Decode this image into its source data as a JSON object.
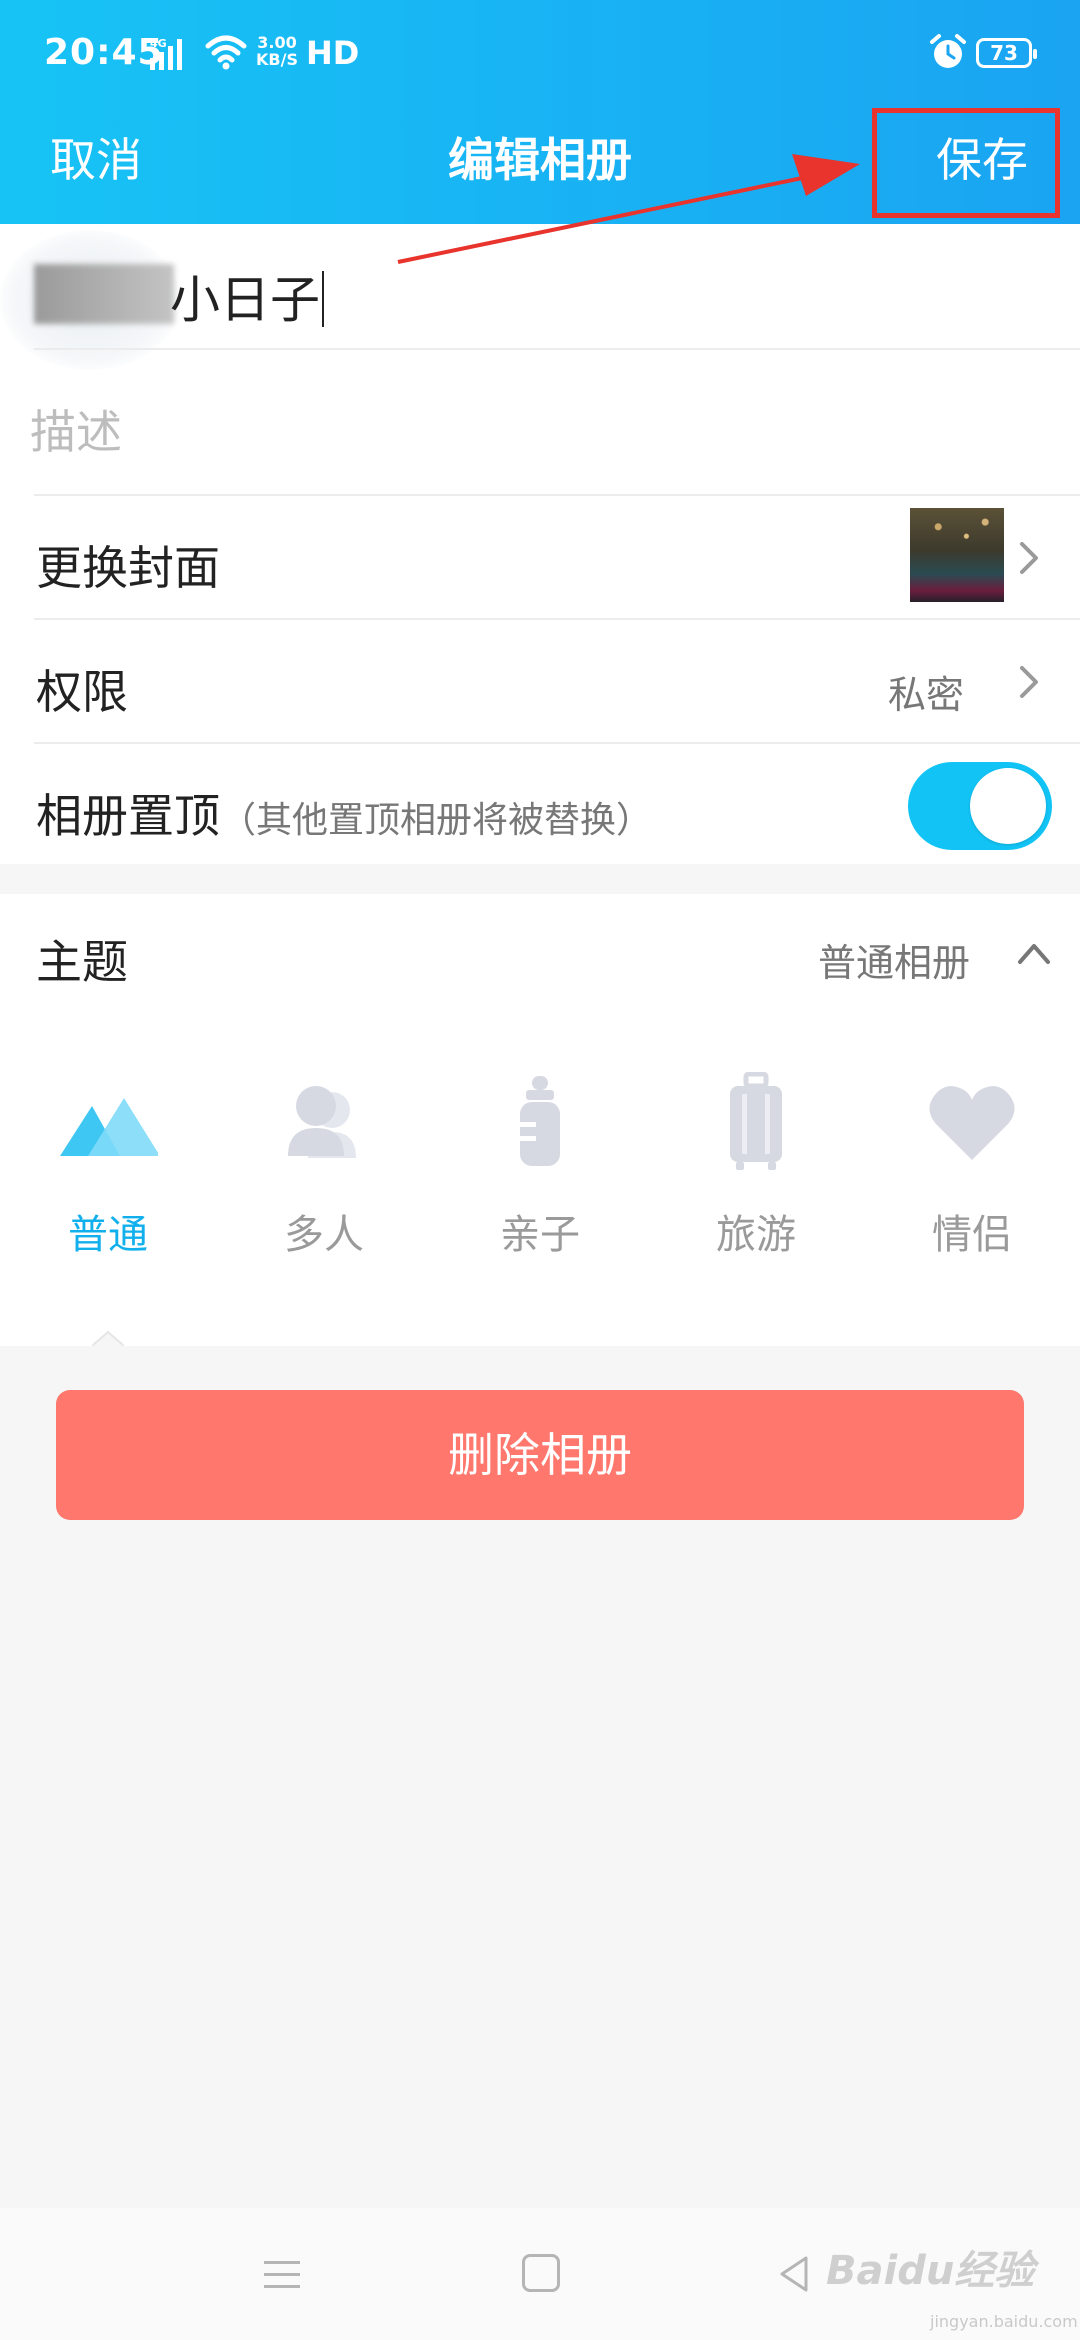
{
  "status_bar": {
    "time": "20:45",
    "network": "4G",
    "speed_value": "3.00",
    "speed_unit": "KB/S",
    "hd": "HD",
    "battery": "73"
  },
  "nav": {
    "cancel": "取消",
    "title": "编辑相册",
    "save": "保存"
  },
  "album": {
    "name": "小日子",
    "description_placeholder": "描述"
  },
  "settings": {
    "cover_label": "更换封面",
    "permission_label": "权限",
    "permission_value": "私密",
    "pin_label": "相册置顶",
    "pin_hint": "（其他置顶相册将被替换）",
    "pin_enabled": true
  },
  "theme": {
    "label": "主题",
    "value": "普通相册",
    "selected": "普通",
    "items": [
      {
        "label": "普通",
        "icon": "mountain-icon"
      },
      {
        "label": "多人",
        "icon": "people-icon"
      },
      {
        "label": "亲子",
        "icon": "baby-bottle-icon"
      },
      {
        "label": "旅游",
        "icon": "luggage-icon"
      },
      {
        "label": "情侣",
        "icon": "heart-icon"
      }
    ]
  },
  "delete_button": "删除相册",
  "watermark": {
    "brand": "Baidu经验",
    "url": "jingyan.baidu.com"
  },
  "colors": {
    "header_start": "#17c3f5",
    "header_end": "#1aa4f2",
    "accent": "#11b0ec",
    "delete": "#ff776d",
    "annotation": "#e8342c"
  }
}
